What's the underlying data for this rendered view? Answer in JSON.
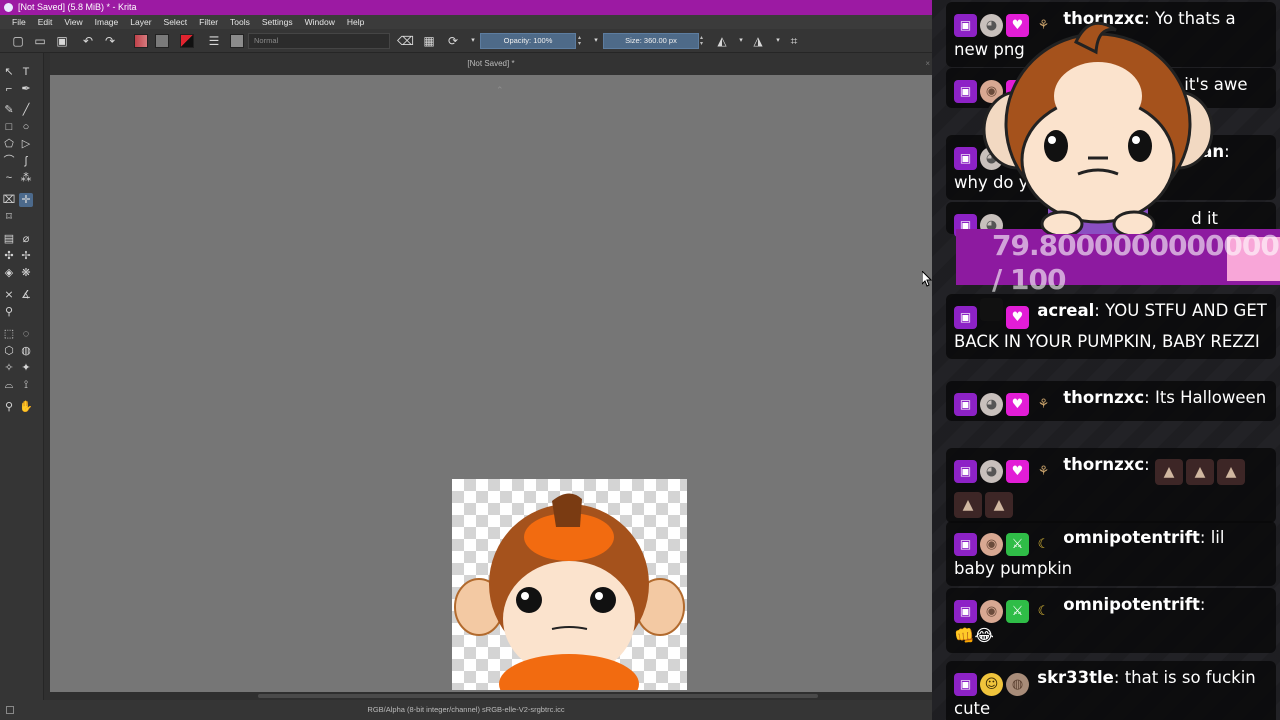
{
  "window": {
    "title": "[Not Saved]  (5.8 MiB)  * - Krita"
  },
  "menu": [
    "File",
    "Edit",
    "View",
    "Image",
    "Layer",
    "Select",
    "Filter",
    "Tools",
    "Settings",
    "Window",
    "Help"
  ],
  "toolbar": {
    "blend_mode": "Normal",
    "opacity": "Opacity: 100%",
    "size": "Size: 360.00 px"
  },
  "document": {
    "tab_title": "[Not Saved]  *",
    "close": "×"
  },
  "statusbar": {
    "color_info": "RGB/Alpha (8-bit integer/channel)  sRGB-elle-V2-srgbtrc.icc"
  },
  "colors": {
    "titlebar": "#9c1aa3",
    "accent": "#4c6a8c",
    "progress_bar": "#8d1aa0",
    "progress_rest": "#f8a6d8"
  },
  "overlay": {
    "progress_text": "79.80000000000001 / 100",
    "progress_value": 79.80000000000001,
    "progress_max": 100
  },
  "chat": {
    "messages": [
      {
        "user": "thornzxc",
        "text": " Yo thats a new png",
        "badges": [
          "twitch-icon",
          "wolf-icon",
          "heart-icon",
          "witch-icon"
        ]
      },
      {
        "user": "_",
        "text": " it's awe",
        "badges": [
          "twitch-icon",
          "bald-icon",
          "heart-icon"
        ]
      },
      {
        "user": "an",
        "text": " why do yo",
        "badges": [
          "twitch-icon",
          "wolf-icon"
        ]
      },
      {
        "user": "",
        "text": "d it",
        "badges": [
          "twitch-icon",
          "wolf-icon"
        ]
      },
      {
        "user": "acreal",
        "text": " YOU STFU AND GET BACK IN YOUR PUMPKIN, BABY REZZI",
        "badges": [
          "twitch-icon",
          "blank-icon",
          "heart-icon"
        ]
      },
      {
        "user": "thornzxc",
        "text": " Its Halloween",
        "badges": [
          "twitch-icon",
          "wolf-icon",
          "heart-icon",
          "witch-icon"
        ]
      },
      {
        "user": "thornzxc",
        "text": "",
        "badges": [
          "twitch-icon",
          "wolf-icon",
          "heart-icon",
          "witch-icon"
        ],
        "emotes": 5
      },
      {
        "user": "omnipotentrift",
        "text": " lil baby pumpkin",
        "badges": [
          "twitch-icon",
          "bald-icon",
          "sword-icon",
          "banana-icon"
        ]
      },
      {
        "user": "omnipotentrift",
        "text": "",
        "badges": [
          "twitch-icon",
          "bald-icon",
          "sword-icon",
          "banana-icon"
        ],
        "emoji": "👊😂"
      },
      {
        "user": "skr33tle",
        "text": " that is so fuckin cute",
        "badges": [
          "twitch-icon",
          "person-icon",
          "fur-icon"
        ]
      }
    ]
  }
}
